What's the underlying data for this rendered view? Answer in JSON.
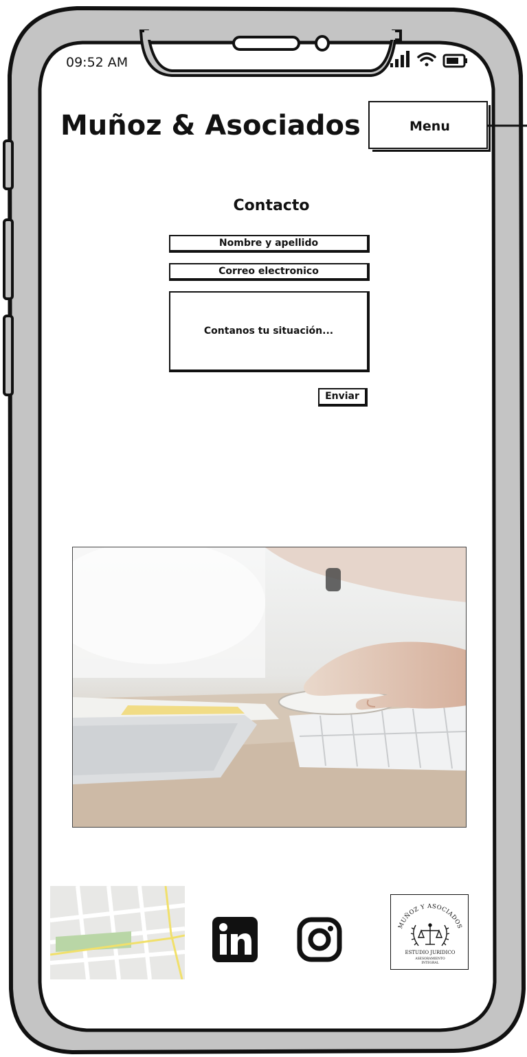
{
  "status_bar": {
    "time": "09:52 AM",
    "icons": [
      "signal-icon",
      "wifi-icon",
      "battery-icon"
    ]
  },
  "header": {
    "brand": "Muñoz & Asociados",
    "menu_label": "Menu"
  },
  "contact": {
    "title": "Contacto",
    "name_placeholder": "Nombre y apellido",
    "email_placeholder": "Correo electronico",
    "message_placeholder": "Contanos tu situación...",
    "submit_label": "Enviar"
  },
  "footer": {
    "social": [
      "linkedin-icon",
      "instagram-icon"
    ],
    "logo": {
      "arc_text": "MUÑOZ Y ASOCIADOS",
      "line1": "ESTUDIO JURIDICO",
      "line2": "ASESORAMIENTO",
      "line3": "INTEGRAL"
    }
  },
  "colors": {
    "frame_gray": "#c4c4c4",
    "ink": "#111111",
    "screen": "#ffffff"
  }
}
